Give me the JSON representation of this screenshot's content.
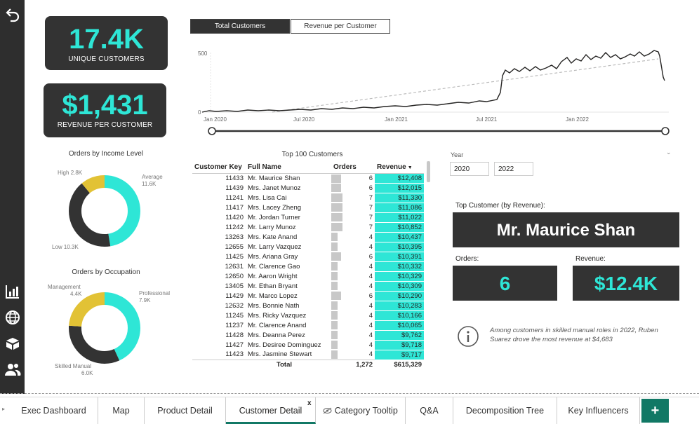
{
  "kpis": {
    "unique_customers": {
      "value": "17.4K",
      "label": "UNIQUE CUSTOMERS"
    },
    "revenue_per_customer": {
      "value": "$1,431",
      "label": "REVENUE PER CUSTOMER"
    }
  },
  "line_tabs": [
    "Total Customers",
    "Revenue per Customer"
  ],
  "line_chart": {
    "y_tick": "500",
    "y_zero": "0",
    "x_ticks": [
      "Jan 2020",
      "Jul 2020",
      "Jan 2021",
      "Jul 2021",
      "Jan 2022"
    ]
  },
  "donuts": {
    "income": {
      "title": "Orders by Income Level",
      "labels": [
        {
          "name": "High",
          "value": "2.8K"
        },
        {
          "name": "Average",
          "value": "11.6K"
        },
        {
          "name": "Low",
          "value": "10.3K"
        }
      ]
    },
    "occupation": {
      "title": "Orders by Occupation",
      "labels": [
        {
          "name": "Management",
          "value": "4.4K"
        },
        {
          "name": "Professional",
          "value": "7.9K"
        },
        {
          "name": "Skilled Manual",
          "value": "6.0K"
        }
      ]
    }
  },
  "table": {
    "title": "Top 100 Customers",
    "headers": [
      "Customer Key",
      "Full Name",
      "Orders",
      "Revenue"
    ],
    "rows": [
      [
        "11433",
        "Mr. Maurice Shan",
        "6",
        "$12,408"
      ],
      [
        "11439",
        "Mrs. Janet Munoz",
        "6",
        "$12,015"
      ],
      [
        "11241",
        "Mrs. Lisa Cai",
        "7",
        "$11,330"
      ],
      [
        "11417",
        "Mrs. Lacey Zheng",
        "7",
        "$11,086"
      ],
      [
        "11420",
        "Mr. Jordan Turner",
        "7",
        "$11,022"
      ],
      [
        "11242",
        "Mr. Larry Munoz",
        "7",
        "$10,852"
      ],
      [
        "13263",
        "Mrs. Kate Anand",
        "4",
        "$10,437"
      ],
      [
        "12655",
        "Mr. Larry Vazquez",
        "4",
        "$10,395"
      ],
      [
        "11425",
        "Mrs. Ariana Gray",
        "6",
        "$10,391"
      ],
      [
        "12631",
        "Mr. Clarence Gao",
        "4",
        "$10,332"
      ],
      [
        "12650",
        "Mr. Aaron Wright",
        "4",
        "$10,329"
      ],
      [
        "13405",
        "Mr. Ethan Bryant",
        "4",
        "$10,309"
      ],
      [
        "11429",
        "Mr. Marco Lopez",
        "6",
        "$10,290"
      ],
      [
        "12632",
        "Mrs. Bonnie Nath",
        "4",
        "$10,283"
      ],
      [
        "11245",
        "Mrs. Ricky Vazquez",
        "4",
        "$10,166"
      ],
      [
        "11237",
        "Mr. Clarence Anand",
        "4",
        "$10,065"
      ],
      [
        "11428",
        "Mrs. Deanna Perez",
        "4",
        "$9,762"
      ],
      [
        "11427",
        "Mrs. Desiree Dominguez",
        "4",
        "$9,718"
      ],
      [
        "11423",
        "Mrs. Jasmine Stewart",
        "4",
        "$9,717"
      ]
    ],
    "total_label": "Total",
    "total_orders": "1,272",
    "total_revenue": "$615,329"
  },
  "year_filter": {
    "label": "Year",
    "from": "2020",
    "to": "2022"
  },
  "top_customer": {
    "label": "Top Customer (by Revenue):",
    "name": "Mr. Maurice Shan",
    "orders_label": "Orders:",
    "orders": "6",
    "revenue_label": "Revenue:",
    "revenue": "$12.4K"
  },
  "insight": "Among customers in skilled manual roles in 2022, Ruben Suarez drove the most revenue at $4,683",
  "page_tabs": [
    "Exec Dashboard",
    "Map",
    "Product Detail",
    "Customer Detail",
    "Category Tooltip",
    "Q&A",
    "Decomposition Tree",
    "Key Influencers"
  ],
  "active_tab": "Customer Detail",
  "close_glyph": "x",
  "add_glyph": "+",
  "colors": {
    "accent": "#2ee6d6",
    "dark": "#333333",
    "yellow": "#e2c235",
    "tab_active": "#117865"
  }
}
